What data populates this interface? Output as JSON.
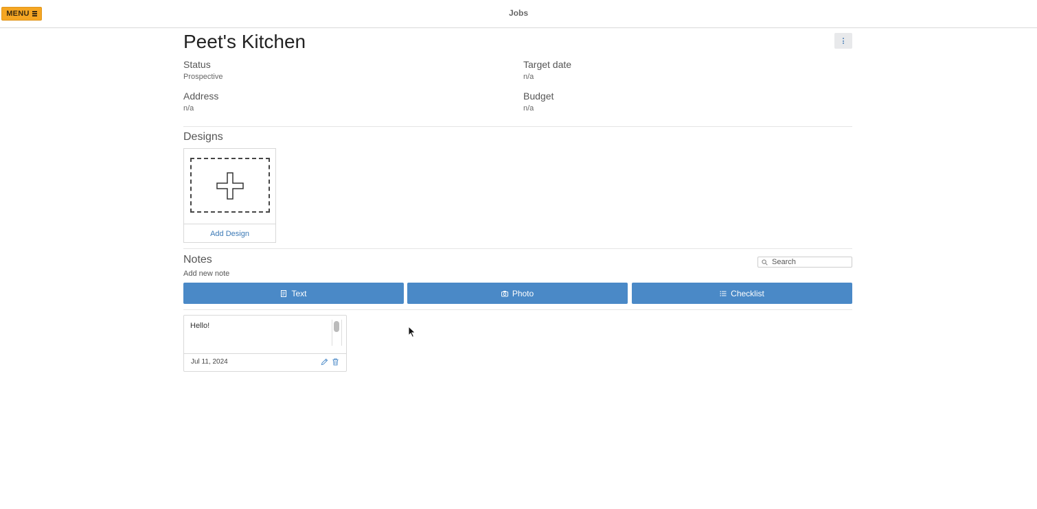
{
  "header": {
    "menu_label": "MENU",
    "title": "Jobs"
  },
  "job": {
    "title": "Peet's Kitchen",
    "fields": {
      "status": {
        "label": "Status",
        "value": "Prospective"
      },
      "target_date": {
        "label": "Target date",
        "value": "n/a"
      },
      "address": {
        "label": "Address",
        "value": "n/a"
      },
      "budget": {
        "label": "Budget",
        "value": "n/a"
      }
    }
  },
  "designs": {
    "title": "Designs",
    "add_label": "Add Design"
  },
  "notes": {
    "title": "Notes",
    "search_placeholder": "Search",
    "add_new_label": "Add new note",
    "buttons": {
      "text": "Text",
      "photo": "Photo",
      "checklist": "Checklist"
    },
    "items": [
      {
        "text": "Hello!",
        "date": "Jul 11, 2024"
      }
    ]
  },
  "colors": {
    "accent": "#4a89c7",
    "menu": "#f5a623",
    "link": "#3a78b5"
  }
}
